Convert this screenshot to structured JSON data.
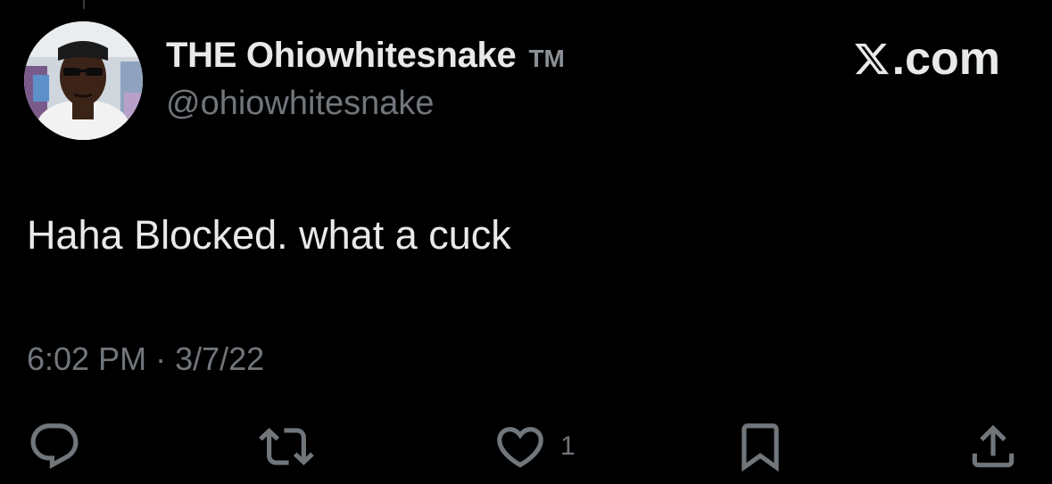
{
  "header": {
    "brand": ".com",
    "brand_icon": "x-logo-icon"
  },
  "author": {
    "display_name": "THE Ohiowhitesnake",
    "tm": "TM",
    "handle": "@ohiowhitesnake"
  },
  "tweet": {
    "text": "Haha Blocked. what a cuck",
    "time": "6:02 PM",
    "separator": "·",
    "date": "3/7/22"
  },
  "actions": {
    "reply_icon": "reply-icon",
    "retweet_icon": "retweet-icon",
    "like_icon": "heart-icon",
    "like_count": "1",
    "bookmark_icon": "bookmark-icon",
    "share_icon": "share-icon"
  },
  "colors": {
    "background": "#000000",
    "primary_text": "#e7e9ea",
    "secondary_text": "#71767b"
  }
}
